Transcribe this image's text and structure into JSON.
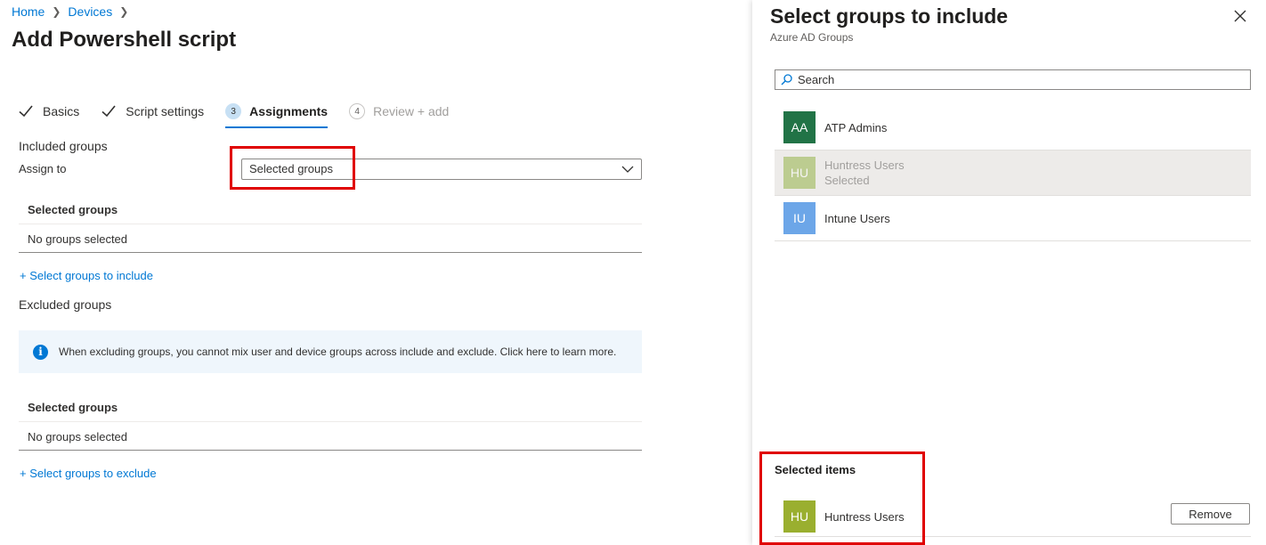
{
  "breadcrumb": {
    "home": "Home",
    "devices": "Devices"
  },
  "page": {
    "title": "Add Powershell script"
  },
  "steps": [
    {
      "num": "",
      "label": "Basics",
      "state": "done"
    },
    {
      "num": "",
      "label": "Script settings",
      "state": "done"
    },
    {
      "num": "3",
      "label": "Assignments",
      "state": "active"
    },
    {
      "num": "4",
      "label": "Review + add",
      "state": "future"
    }
  ],
  "included": {
    "section_label": "Included groups",
    "assign_to_label": "Assign to",
    "assign_to_value": "Selected groups",
    "table_header": "Selected groups",
    "empty_text": "No groups selected",
    "add_link": "+ Select groups to include"
  },
  "excluded": {
    "section_label": "Excluded groups",
    "info_text": "When excluding groups, you cannot mix user and device groups across include and exclude. Click here to learn more.",
    "table_header": "Selected groups",
    "empty_text": "No groups selected",
    "add_link": "+ Select groups to exclude"
  },
  "panel": {
    "title": "Select groups to include",
    "subtitle": "Azure AD Groups",
    "search_placeholder": "Search",
    "groups": [
      {
        "initials": "AA",
        "name": "ATP Admins",
        "status": "",
        "color": "#217346"
      },
      {
        "initials": "HU",
        "name": "Huntress Users",
        "status": "Selected",
        "color": "#8cae3a"
      },
      {
        "initials": "IU",
        "name": "Intune Users",
        "status": "",
        "color": "#6ca6e8"
      }
    ],
    "selected_title": "Selected items",
    "selected_item": {
      "initials": "HU",
      "name": "Huntress Users",
      "color": "#9aaf2f"
    },
    "remove_label": "Remove"
  },
  "colors": {
    "accent": "#0078d4",
    "highlight": "#e00000"
  }
}
